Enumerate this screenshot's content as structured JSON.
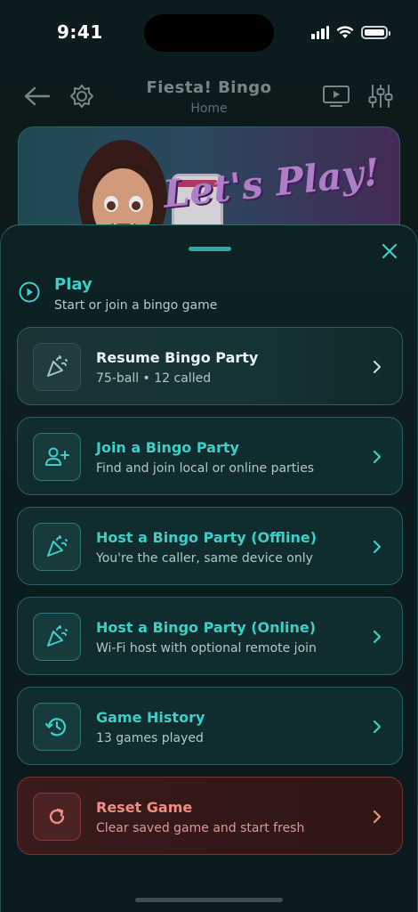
{
  "status_bar": {
    "time": "9:41"
  },
  "nav": {
    "title": "Fiesta! Bingo",
    "subtitle": "Home"
  },
  "banner": {
    "text": "Let's Play!"
  },
  "sheet": {
    "section_title": "Play",
    "section_subtitle": "Start or join a bingo game",
    "items": [
      {
        "title": "Resume Bingo Party",
        "subtitle": "75-ball • 12 called",
        "icon": "party-popper-icon"
      },
      {
        "title": "Join a Bingo Party",
        "subtitle": "Find and join local or online parties",
        "icon": "users-add-icon"
      },
      {
        "title": "Host a Bingo Party (Offline)",
        "subtitle": "You're the caller, same device only",
        "icon": "party-popper-icon"
      },
      {
        "title": "Host a Bingo Party (Online)",
        "subtitle": "Wi-Fi host with optional remote join",
        "icon": "party-popper-icon"
      },
      {
        "title": "Game History",
        "subtitle": "13 games played",
        "icon": "history-icon"
      },
      {
        "title": "Reset Game",
        "subtitle": "Clear saved game and start fresh",
        "icon": "refresh-icon"
      }
    ]
  },
  "colors": {
    "accent": "#3ad0c8",
    "danger": "#f08e83",
    "background": "#0b1a1c"
  }
}
